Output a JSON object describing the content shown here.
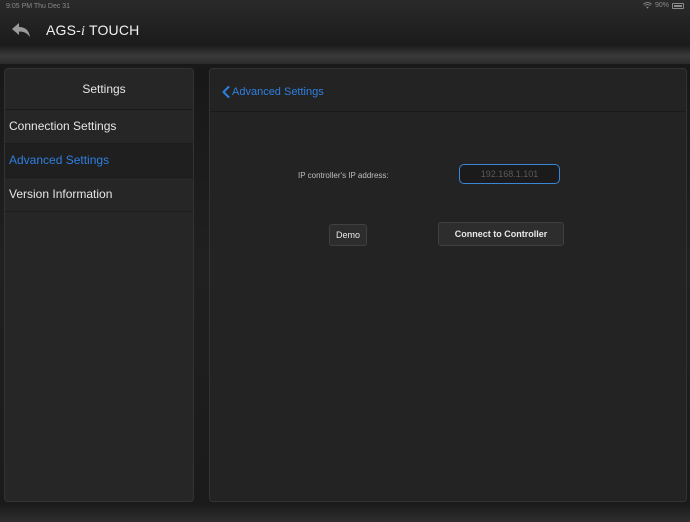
{
  "status_bar": {
    "time": "9:05 PM  Thu Dec 31",
    "battery": "90%"
  },
  "header": {
    "title_prefix": "AGS-",
    "title_i": "i",
    "title_suffix": " TOUCH"
  },
  "sidebar": {
    "title": "Settings",
    "items": [
      {
        "label": "Connection Settings",
        "selected": false
      },
      {
        "label": "Advanced Settings",
        "selected": true
      },
      {
        "label": "Version Information",
        "selected": false
      }
    ]
  },
  "main": {
    "nav_back_label": "Advanced Settings",
    "ip_label": "IP controller's IP address:",
    "ip_placeholder": "192.168.1.101",
    "ip_value": "",
    "demo_label": "Demo",
    "connect_label": "Connect to Controller"
  },
  "colors": {
    "accent": "#2f7fe0",
    "background": "#1c1c1c",
    "panel": "#232323"
  },
  "icons": {
    "back": "back-arrow-icon",
    "nav_back": "chevron-left-icon",
    "wifi": "wifi-icon",
    "battery": "battery-icon"
  }
}
